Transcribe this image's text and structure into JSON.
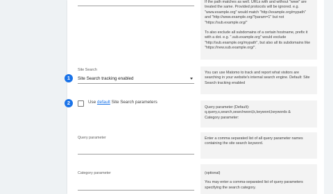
{
  "help_blocks": {
    "domains": [
      "If the path matches as well. URLs with and without \"www\" are treated the same. Provided protocols will be ignored. e.g. \"www.example.org\" would match \"http://example.org/mypath\" and \"http://www.example.org/?param=1\" but not \"https://sub.example.org/\"",
      "To also exclude all subdomains of a certain hostname, prefix it with a dot. e.g. \".sub.example.org\" would exclude \"http://sub.example.org/mypath\", but also all its subdomains like \"https://new.sub.example.org/\"."
    ],
    "site_search": "You can use Matomo to track and report what visitors are searching in your website's internal search engine. Default: Site Search tracking enabled",
    "query_default": [
      "Query parameter (Default):",
      "q,query,s,search,searchword,k,keyword,keywords &",
      "Category parameter:"
    ],
    "query_param": "Enter a comma separated list of all query parameter names containing the site search keyword.",
    "category_param": [
      "(optional)",
      "You may enter a comma-separated list of query parameters specifying the search category."
    ]
  },
  "site_search": {
    "step": "1",
    "label": "Site Search",
    "value": "Site Search tracking enabled"
  },
  "default_params": {
    "step": "2",
    "prefix": "Use ",
    "link": "default",
    "suffix": " Site Search parameters"
  },
  "query_parameter": {
    "label": "Query parameter",
    "value": ""
  },
  "category_parameter": {
    "label": "Category parameter",
    "value": ""
  },
  "colors": {
    "accent": "#1a73e8",
    "help_bg": "#f3f3f3"
  }
}
